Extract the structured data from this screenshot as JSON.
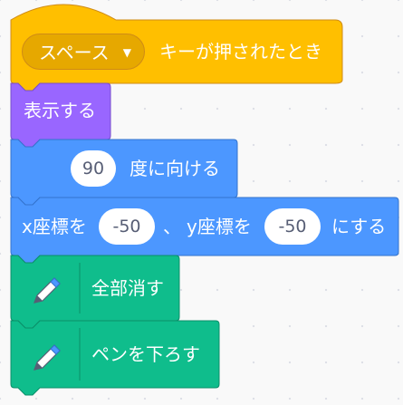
{
  "colors": {
    "events": "#ffbf00",
    "looks": "#9966ff",
    "motion": "#4c97ff",
    "pen": "#0fbd8c"
  },
  "blocks": {
    "when_key_pressed": {
      "key_option": "スペース",
      "dropdown_icon": "dropdown-arrow",
      "suffix": "キーが押されたとき"
    },
    "show": {
      "label": "表示する"
    },
    "point_direction": {
      "value": "90",
      "suffix": "度に向ける"
    },
    "go_to_xy": {
      "x_label": "x座標を",
      "x_value": "-50",
      "sep": "、",
      "y_label": "y座標を",
      "y_value": "-50",
      "suffix": "にする"
    },
    "erase_all": {
      "icon": "pen-icon",
      "label": "全部消す"
    },
    "pen_down": {
      "icon": "pen-icon",
      "label": "ペンを下ろす"
    }
  }
}
